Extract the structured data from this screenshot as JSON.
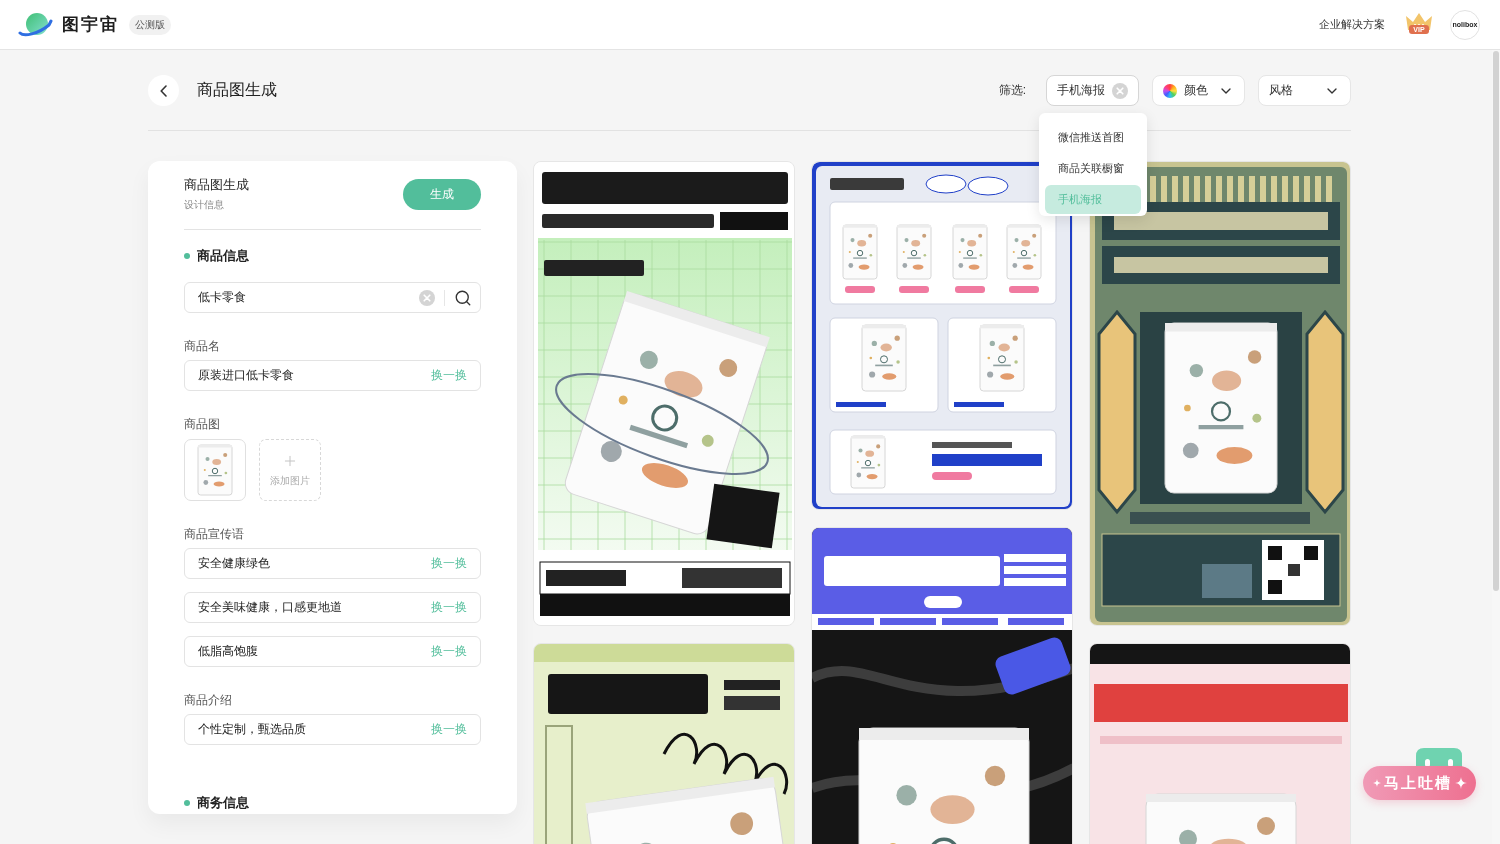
{
  "topbar": {
    "brand": "图宇宙",
    "badge": "公测版",
    "link": "企业解决方案",
    "vip_label": "VIP",
    "avatar_text": "nolibox"
  },
  "page": {
    "title": "商品图生成"
  },
  "filters": {
    "label": "筛选:",
    "items": [
      {
        "kind": "clearable",
        "value": "手机海报",
        "expanded": true,
        "options": [
          {
            "label": "微信推送首图",
            "selected": false
          },
          {
            "label": "商品关联橱窗",
            "selected": false
          },
          {
            "label": "手机海报",
            "selected": true
          }
        ]
      },
      {
        "kind": "color",
        "value": "颜色",
        "expanded": false
      },
      {
        "kind": "dropdown",
        "value": "风格",
        "expanded": false
      }
    ]
  },
  "panel": {
    "title": "商品图生成",
    "subtitle": "设计信息",
    "action": "生成",
    "sections": [
      {
        "title": "商品信息",
        "search": {
          "value": "低卡零食"
        },
        "groups": [
          {
            "kind": "inputs",
            "label": "商品名",
            "inputs": [
              {
                "value": "原装进口低卡零食",
                "action": "换一换"
              }
            ]
          },
          {
            "kind": "images",
            "label": "商品图",
            "add_label": "添加图片"
          },
          {
            "kind": "inputs",
            "label": "商品宣传语",
            "inputs": [
              {
                "value": "安全健康绿色",
                "action": "换一换"
              },
              {
                "value": "安全美味健康，口感更地道",
                "action": "换一换"
              },
              {
                "value": "低脂高饱腹",
                "action": "换一换"
              }
            ]
          },
          {
            "kind": "inputs",
            "label": "商品介绍",
            "inputs": [
              {
                "value": "个性定制，甄选品质",
                "action": "换一换"
              }
            ]
          }
        ]
      },
      {
        "title": "商务信息"
      }
    ]
  },
  "gallery": {
    "columns": [
      {
        "posters": [
          {
            "kind": "grid"
          },
          {
            "kind": "lime"
          }
        ]
      },
      {
        "posters": [
          {
            "kind": "frame"
          },
          {
            "kind": "awesome"
          }
        ]
      },
      {
        "posters": [
          {
            "kind": "retro"
          },
          {
            "kind": "carnival"
          }
        ]
      }
    ]
  },
  "feedback_button": "马上吐槽"
}
